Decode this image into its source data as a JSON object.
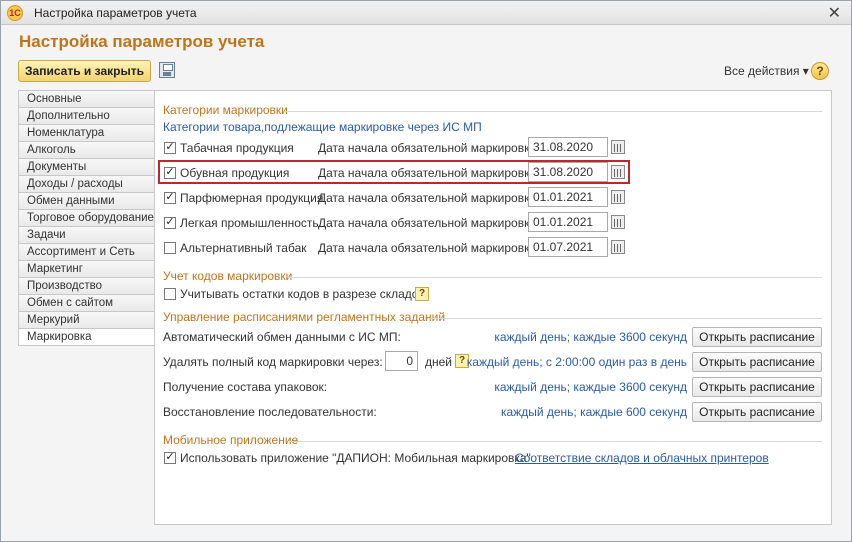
{
  "window": {
    "title": "Настройка параметров учета",
    "logo": "1С"
  },
  "form": {
    "title": "Настройка параметров учета"
  },
  "toolbar": {
    "save_close": "Записать и закрыть",
    "all_actions": "Все действия ▾",
    "help": "?"
  },
  "tabs": [
    {
      "label": "Основные"
    },
    {
      "label": "Дополнительно"
    },
    {
      "label": "Номенклатура"
    },
    {
      "label": "Алкоголь"
    },
    {
      "label": "Документы"
    },
    {
      "label": "Доходы / расходы"
    },
    {
      "label": "Обмен данными"
    },
    {
      "label": "Торговое оборудование"
    },
    {
      "label": "Задачи"
    },
    {
      "label": "Ассортимент и Сеть"
    },
    {
      "label": "Маркетинг"
    },
    {
      "label": "Производство"
    },
    {
      "label": "Обмен с сайтом"
    },
    {
      "label": "Меркурий"
    },
    {
      "label": "Маркировка"
    }
  ],
  "active_tab": "Маркировка",
  "marking": {
    "section_title": "Категории маркировки",
    "subtitle": "Категории товара,подлежащие маркировке через ИС МП",
    "date_label": "Дата начала обязательной маркировки:",
    "categories": [
      {
        "name": "Табачная продукция",
        "checked": true,
        "date": "31.08.2020"
      },
      {
        "name": "Обувная продукция",
        "checked": true,
        "date": "31.08.2020"
      },
      {
        "name": "Парфюмерная продукция",
        "checked": true,
        "date": "01.01.2021"
      },
      {
        "name": "Легкая промышленность",
        "checked": true,
        "date": "01.01.2021"
      },
      {
        "name": "Альтернативный табак",
        "checked": false,
        "date": "01.07.2021"
      }
    ]
  },
  "codes": {
    "section_title": "Учет кодов маркировки",
    "checkbox_label": "Учитывать остатки кодов в разрезе складов",
    "checked": false,
    "hint": "?"
  },
  "schedule": {
    "section_title": "Управление расписаниями регламентных заданий",
    "button_label": "Открыть расписание",
    "rows": [
      {
        "label": "Автоматический обмен данными с ИС МП:",
        "schedule": "каждый день; каждые 3600 секунд"
      },
      {
        "label": "Удалять полный код маркировки через:",
        "value": "0",
        "unit": "дней",
        "hint": "?",
        "schedule": "каждый день; с 2:00:00 один раз в день"
      },
      {
        "label": "Получение состава упаковок:",
        "schedule": "каждый день; каждые 3600 секунд"
      },
      {
        "label": "Восстановление последовательности:",
        "schedule": "каждый день; каждые 600 секунд"
      }
    ]
  },
  "mobile": {
    "section_title": "Мобильное приложение",
    "checkbox_label": "Использовать приложение \"ДАПИОН: Мобильная маркировка\"",
    "checked": true,
    "link": "Соответствие складов и облачных принтеров"
  },
  "colors": {
    "accent": "#c0741a",
    "link": "#2a5ba7",
    "highlight": "#c0262d",
    "primary_button": "#f2d36e"
  }
}
